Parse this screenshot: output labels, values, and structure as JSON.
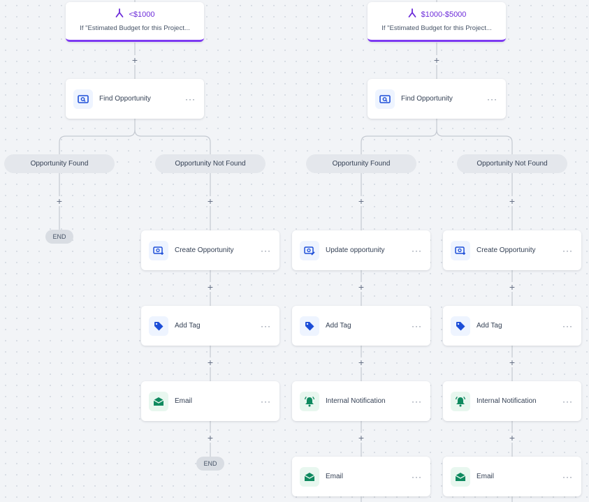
{
  "branches": [
    {
      "title": "<$1000",
      "subtitle": "If \"Estimated Budget for this Project..."
    },
    {
      "title": "$1000-$5000",
      "subtitle": "If \"Estimated Budget for this Project..."
    }
  ],
  "actions": {
    "find_opportunity": "Find Opportunity",
    "create_opportunity": "Create Opportunity",
    "update_opportunity": "Update opportunity",
    "add_tag": "Add Tag",
    "email": "Email",
    "internal_notification": "Internal Notification"
  },
  "conditions": {
    "found": "Opportunity Found",
    "not_found": "Opportunity Not Found"
  },
  "end_label": "END",
  "more_label": "···",
  "plus_label": "+",
  "colors": {
    "branch_accent": "#7e3af2",
    "icon_blue": "#1d4ed8",
    "icon_green": "#0f8a5f"
  }
}
